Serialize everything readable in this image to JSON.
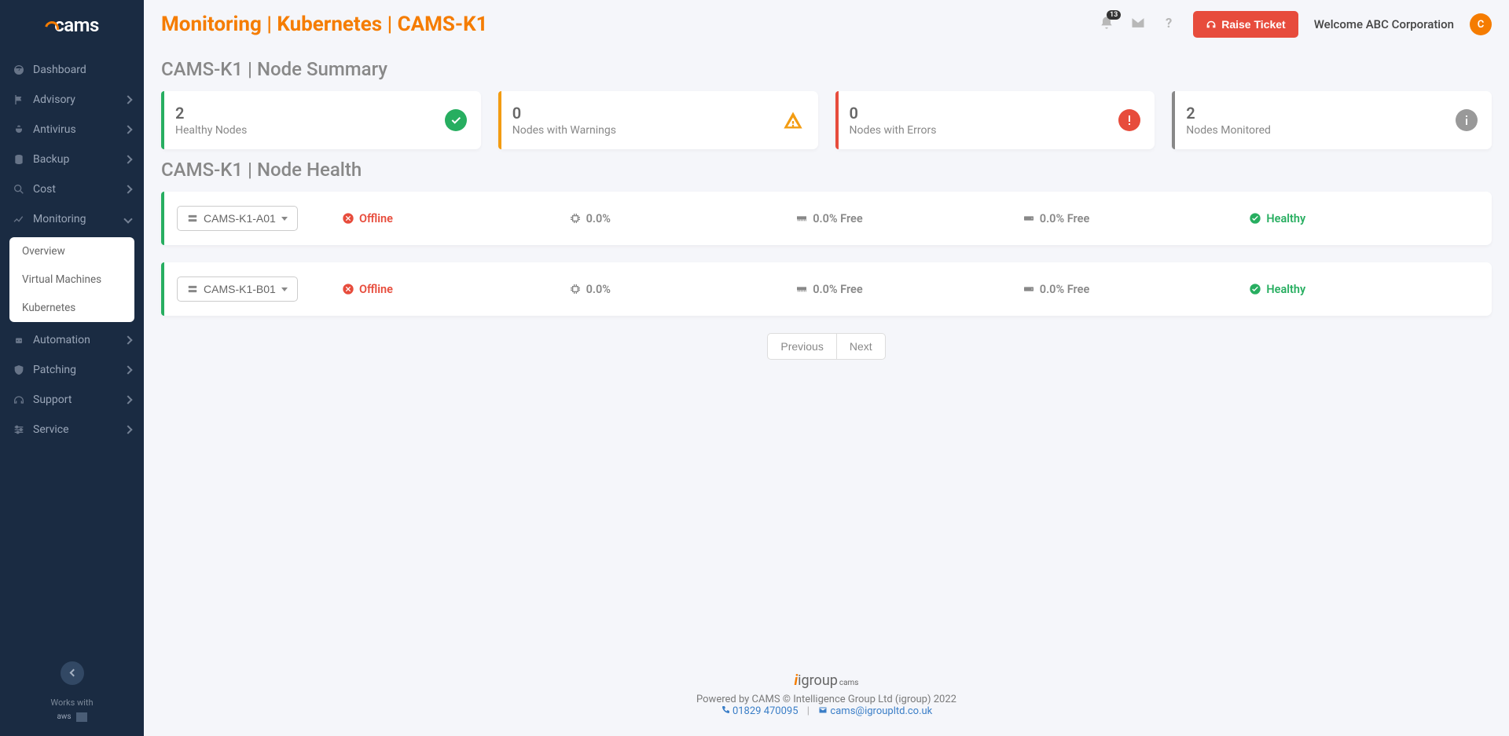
{
  "brand": "cams",
  "header": {
    "breadcrumb": "Monitoring | Kubernetes | CAMS-K1",
    "notification_count": "13",
    "raise_ticket": "Raise Ticket",
    "welcome": "Welcome ABC Corporation",
    "avatar_letter": "C"
  },
  "sidebar": {
    "items": [
      {
        "label": "Dashboard",
        "expandable": false
      },
      {
        "label": "Advisory",
        "expandable": true
      },
      {
        "label": "Antivirus",
        "expandable": true
      },
      {
        "label": "Backup",
        "expandable": true
      },
      {
        "label": "Cost",
        "expandable": true
      },
      {
        "label": "Monitoring",
        "expandable": true,
        "open": true
      },
      {
        "label": "Automation",
        "expandable": true
      },
      {
        "label": "Patching",
        "expandable": true
      },
      {
        "label": "Support",
        "expandable": true
      },
      {
        "label": "Service",
        "expandable": true
      }
    ],
    "submenu": [
      {
        "label": "Overview"
      },
      {
        "label": "Virtual Machines"
      },
      {
        "label": "Kubernetes"
      }
    ],
    "works_with": "Works with",
    "aws": "aws"
  },
  "summary": {
    "title": "CAMS-K1 | Node Summary",
    "cards": [
      {
        "value": "2",
        "label": "Healthy Nodes"
      },
      {
        "value": "0",
        "label": "Nodes with Warnings"
      },
      {
        "value": "0",
        "label": "Nodes with Errors"
      },
      {
        "value": "2",
        "label": "Nodes Monitored"
      }
    ]
  },
  "health": {
    "title": "CAMS-K1 | Node Health",
    "nodes": [
      {
        "name": "CAMS-K1-A01",
        "status": "Offline",
        "cpu": "0.0%",
        "mem": "0.0% Free",
        "disk": "0.0% Free",
        "health": "Healthy"
      },
      {
        "name": "CAMS-K1-B01",
        "status": "Offline",
        "cpu": "0.0%",
        "mem": "0.0% Free",
        "disk": "0.0% Free",
        "health": "Healthy"
      }
    ],
    "prev": "Previous",
    "next": "Next"
  },
  "footer": {
    "brand": "igroup",
    "brand_suffix": "cams",
    "powered": "Powered by CAMS © Intelligence Group Ltd (igroup) 2022",
    "phone": "01829 470095",
    "email": "cams@igroupltd.co.uk"
  }
}
